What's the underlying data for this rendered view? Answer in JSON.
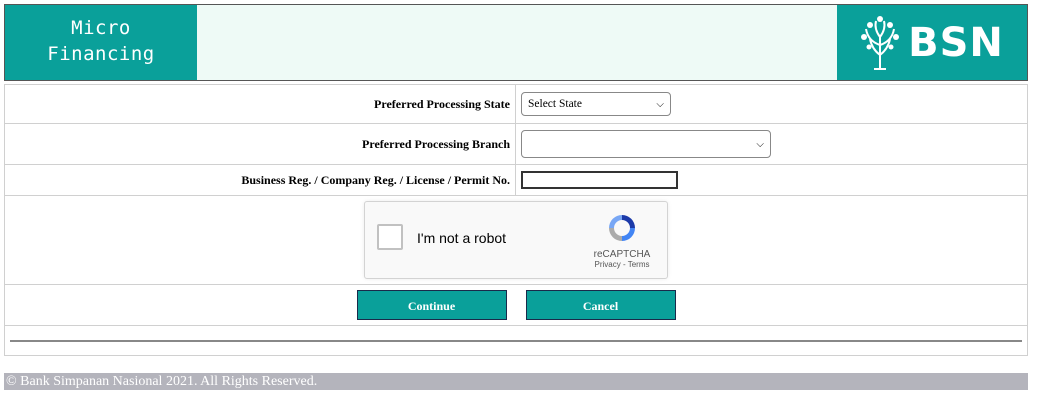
{
  "header": {
    "title_line1": "Micro",
    "title_line2": "Financing",
    "logo_text": "BSN",
    "brand_color": "#0aa09a"
  },
  "form": {
    "state_label": "Preferred Processing State",
    "state_value": "Select State",
    "branch_label": "Preferred Processing Branch",
    "branch_value": "",
    "reg_label": "Business Reg. / Company Reg. / License / Permit No.",
    "reg_value": ""
  },
  "captcha": {
    "label": "I'm not a robot",
    "brand": "reCAPTCHA",
    "links": "Privacy - Terms"
  },
  "buttons": {
    "continue_label": "Continue",
    "cancel_label": "Cancel"
  },
  "footer": {
    "text": "© Bank Simpanan Nasional 2021. All Rights Reserved."
  }
}
